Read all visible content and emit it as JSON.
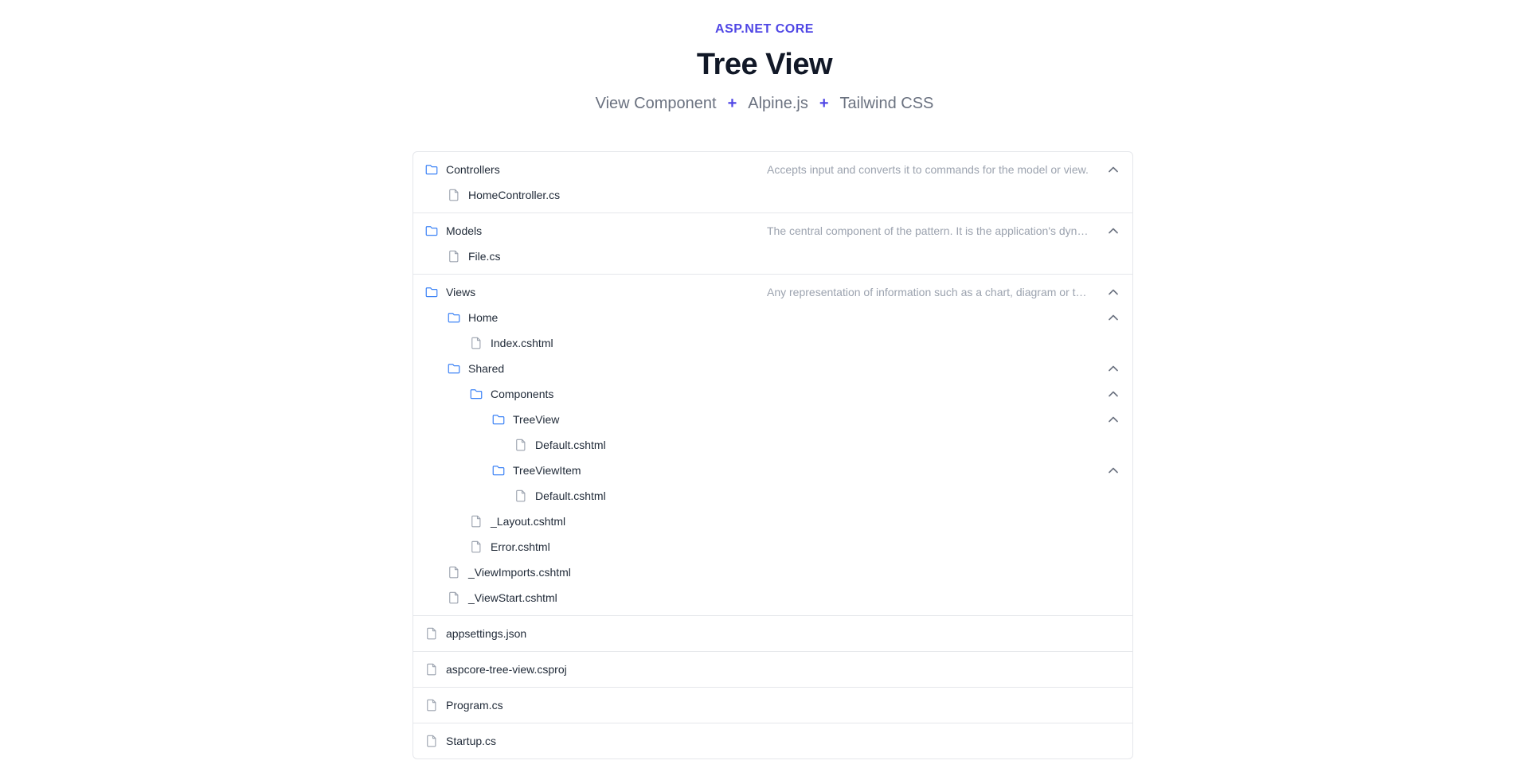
{
  "header": {
    "eyebrow": "ASP.NET CORE",
    "title": "Tree View",
    "subtitle_parts": [
      "View Component",
      "Alpine.js",
      "Tailwind CSS"
    ],
    "separator": "+"
  },
  "colors": {
    "accent": "#4f46e5",
    "folder_icon": "#3b82f6",
    "file_icon": "#9ca3af",
    "chevron": "#6b7280",
    "border": "#e5e7eb",
    "description": "#9ca3af"
  },
  "tree": {
    "controllers": {
      "label": "Controllers",
      "description": "Accepts input and converts it to commands for the model or view.",
      "files": [
        "HomeController.cs"
      ]
    },
    "models": {
      "label": "Models",
      "description": "The central component of the pattern. It is the application's dynamic data structure.",
      "files": [
        "File.cs"
      ]
    },
    "views": {
      "label": "Views",
      "description": "Any representation of information such as a chart, diagram or table.",
      "home": {
        "label": "Home",
        "files": [
          "Index.cshtml"
        ]
      },
      "shared": {
        "label": "Shared",
        "components": {
          "label": "Components",
          "treeview": {
            "label": "TreeView",
            "files": [
              "Default.cshtml"
            ]
          },
          "treeviewitem": {
            "label": "TreeViewItem",
            "files": [
              "Default.cshtml"
            ]
          }
        },
        "files": [
          "_Layout.cshtml",
          "Error.cshtml"
        ]
      },
      "files": [
        "_ViewImports.cshtml",
        "_ViewStart.cshtml"
      ]
    },
    "root_files": [
      "appsettings.json",
      "aspcore-tree-view.csproj",
      "Program.cs",
      "Startup.cs"
    ]
  },
  "icons": {
    "folder": "folder-icon",
    "file": "file-icon",
    "chevron": "chevron-up-icon"
  }
}
